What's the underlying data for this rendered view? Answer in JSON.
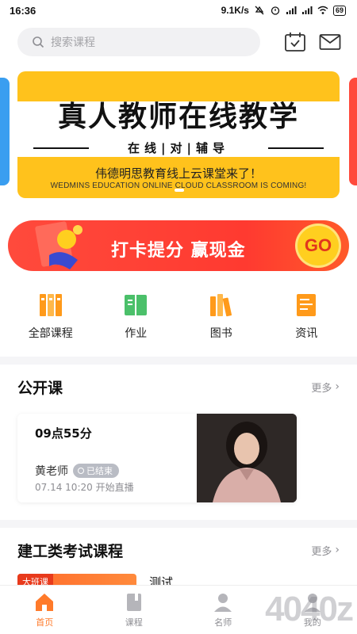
{
  "status_bar": {
    "time": "16:36",
    "speed": "9.1K/s",
    "battery": "69"
  },
  "header": {
    "search_placeholder": "搜索课程"
  },
  "banner": {
    "title": "真人教师在线教学",
    "subtitle": "在线|对|辅导",
    "slogan": "伟德明思教育线上云课堂来了！",
    "slogan_en": "WEDMINS EDUCATION ONLINE CLOUD CLASSROOM IS COMING!"
  },
  "promo": {
    "text": "打卡提分 赢现金",
    "go": "GO"
  },
  "quick_nav": [
    {
      "label": "全部课程",
      "icon": "bookshelf-icon",
      "color": "#ff9a1a"
    },
    {
      "label": "作业",
      "icon": "open-book-icon",
      "color": "#4bc06a"
    },
    {
      "label": "图书",
      "icon": "books-icon",
      "color": "#ff9a1a"
    },
    {
      "label": "资讯",
      "icon": "document-icon",
      "color": "#ff9a1a"
    }
  ],
  "public_course": {
    "title": "公开课",
    "more": "更多",
    "card": {
      "time": "09点55分",
      "teacher": "黄老师",
      "status": "已结束",
      "schedule": "07.14 10:20 开始直播"
    }
  },
  "construction": {
    "title": "建工类考试课程",
    "more": "更多",
    "course": {
      "tag": "大班课",
      "title": "测试"
    }
  },
  "tabs": [
    {
      "label": "首页",
      "icon": "home-icon",
      "active": true
    },
    {
      "label": "课程",
      "icon": "course-icon",
      "active": false
    },
    {
      "label": "名师",
      "icon": "teacher-icon",
      "active": false
    },
    {
      "label": "我的",
      "icon": "profile-icon",
      "active": false
    }
  ],
  "watermark": "4040z",
  "colors": {
    "accent": "#ff7a2a",
    "banner_yellow": "#ffc21c",
    "promo_red": "#ff4a3c"
  }
}
